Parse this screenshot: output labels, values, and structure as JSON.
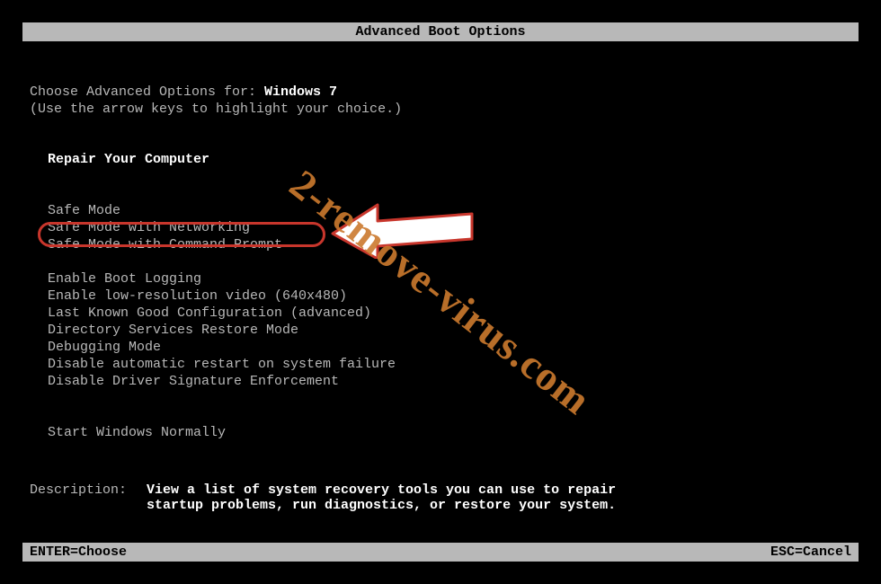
{
  "title": "Advanced Boot Options",
  "prompt": {
    "label": "Choose Advanced Options for: ",
    "os": "Windows 7"
  },
  "instruction": "(Use the arrow keys to highlight your choice.)",
  "menu": {
    "group1": [
      "Repair Your Computer"
    ],
    "group2": [
      "Safe Mode",
      "Safe Mode with Networking",
      "Safe Mode with Command Prompt"
    ],
    "group3": [
      "Enable Boot Logging",
      "Enable low-resolution video (640x480)",
      "Last Known Good Configuration (advanced)",
      "Directory Services Restore Mode",
      "Debugging Mode",
      "Disable automatic restart on system failure",
      "Disable Driver Signature Enforcement"
    ],
    "group4": [
      "Start Windows Normally"
    ]
  },
  "selected_index": 0,
  "highlighted_option": "Safe Mode with Command Prompt",
  "description": {
    "label": "Description:",
    "text_line1": "View a list of system recovery tools you can use to repair",
    "text_line2": "startup problems, run diagnostics, or restore your system."
  },
  "footer": {
    "left": "ENTER=Choose",
    "right": "ESC=Cancel"
  },
  "watermark": "2-remove-virus.com",
  "annotation": {
    "highlight_color": "#c8362c",
    "arrow_fill": "#ffffff"
  }
}
